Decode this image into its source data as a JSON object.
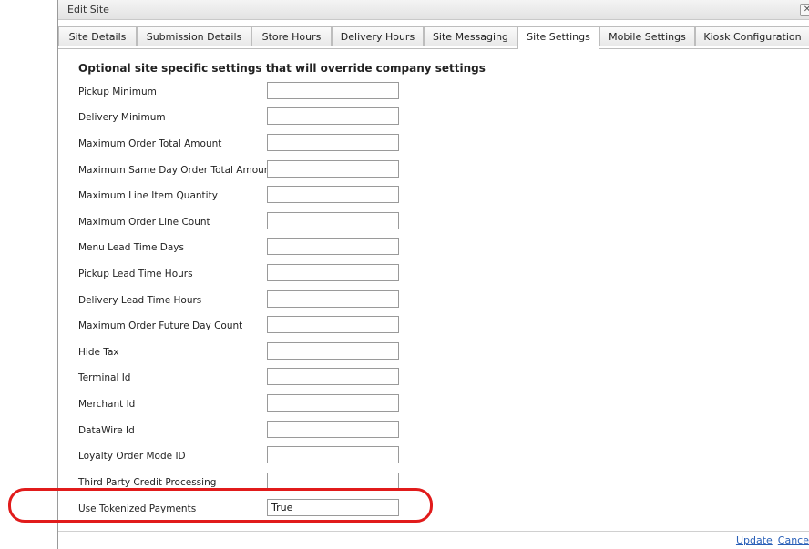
{
  "dialog": {
    "title": "Edit Site",
    "close_glyph": "✕"
  },
  "tabs": [
    {
      "label": "Site Details",
      "active": false
    },
    {
      "label": "Submission Details",
      "active": false
    },
    {
      "label": "Store Hours",
      "active": false
    },
    {
      "label": "Delivery Hours",
      "active": false
    },
    {
      "label": "Site Messaging",
      "active": false
    },
    {
      "label": "Site Settings",
      "active": true
    },
    {
      "label": "Mobile Settings",
      "active": false
    },
    {
      "label": "Kiosk Configuration",
      "active": false
    }
  ],
  "settings": {
    "heading": "Optional site specific settings that will override company settings",
    "fields": [
      {
        "label": "Pickup Minimum",
        "value": ""
      },
      {
        "label": "Delivery Minimum",
        "value": ""
      },
      {
        "label": "Maximum Order Total Amount",
        "value": ""
      },
      {
        "label": "Maximum Same Day Order Total Amount",
        "value": ""
      },
      {
        "label": "Maximum Line Item Quantity",
        "value": ""
      },
      {
        "label": "Maximum Order Line Count",
        "value": ""
      },
      {
        "label": "Menu Lead Time Days",
        "value": ""
      },
      {
        "label": "Pickup Lead Time Hours",
        "value": ""
      },
      {
        "label": "Delivery Lead Time Hours",
        "value": ""
      },
      {
        "label": "Maximum Order Future Day Count",
        "value": ""
      },
      {
        "label": "Hide Tax",
        "value": ""
      },
      {
        "label": "Terminal Id",
        "value": ""
      },
      {
        "label": "Merchant Id",
        "value": ""
      },
      {
        "label": "DataWire Id",
        "value": ""
      },
      {
        "label": "Loyalty Order Mode ID",
        "value": ""
      },
      {
        "label": "Third Party Credit Processing",
        "value": ""
      },
      {
        "label": "Use Tokenized Payments",
        "value": "True"
      }
    ]
  },
  "footer": {
    "update_label": "Update",
    "cancel_label": "Cance"
  },
  "colors": {
    "highlight": "#e11b1b",
    "link": "#2a60b8"
  }
}
